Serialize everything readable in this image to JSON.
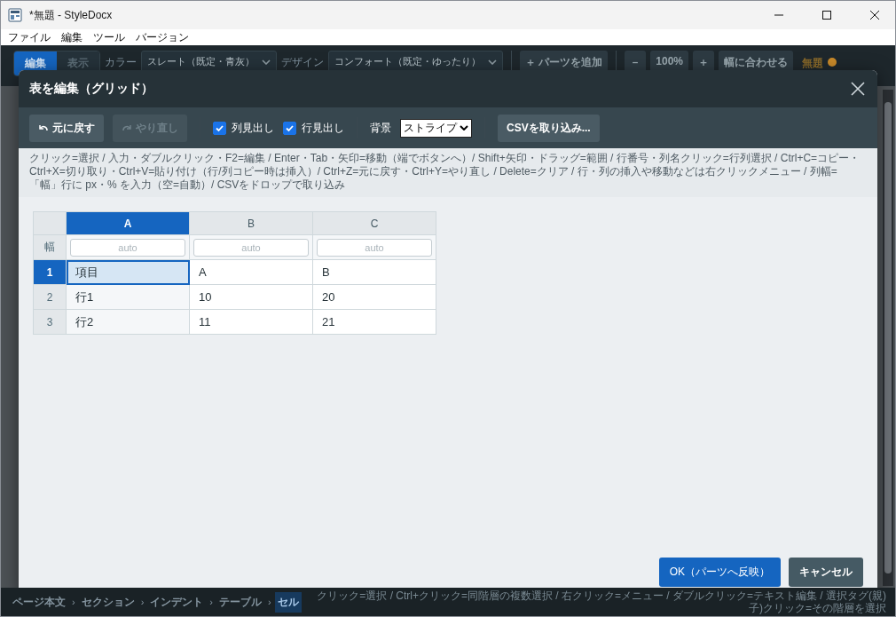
{
  "window": {
    "title": "*無題 - StyleDocx"
  },
  "menu": [
    "ファイル",
    "編集",
    "ツール",
    "バージョン"
  ],
  "app_toolbar": {
    "modes": [
      {
        "label": "編集",
        "selected": true
      },
      {
        "label": "表示",
        "selected": false
      }
    ],
    "color_label": "カラー",
    "color_value": "スレート（既定・青灰）",
    "design_label": "デザイン",
    "design_value": "コンフォート（既定・ゆったり）",
    "add_part": "＋ パーツを追加",
    "zoom_out": "－",
    "zoom": "100%",
    "zoom_in": "＋",
    "fit_width": "幅に合わせる",
    "doc_name": "無題"
  },
  "dialog": {
    "title": "表を編集（グリッド）",
    "undo": {
      "label": "元に戻す",
      "disabled": false
    },
    "redo": {
      "label": "やり直し",
      "disabled": true
    },
    "checks": [
      {
        "label": "列見出し",
        "checked": true
      },
      {
        "label": "行見出し",
        "checked": true
      }
    ],
    "background_label": "背景",
    "background_value": "ストライプ",
    "csv_button": "CSVを取り込み...",
    "help": "クリック=選択 / 入力・ダブルクリック・F2=編集 / Enter・Tab・矢印=移動（端でボタンへ）/ Shift+矢印・ドラッグ=範囲 / 行番号・列名クリック=行列選択 / Ctrl+C=コピー・Ctrl+X=切り取り・Ctrl+V=貼り付け（行/列コピー時は挿入）/ Ctrl+Z=元に戻す・Ctrl+Y=やり直し / Delete=クリア / 行・列の挿入や移動などは右クリックメニュー / 列幅=「幅」行に px・% を入力（空=自動）/ CSVをドロップで取り込み",
    "grid": {
      "width_label": "幅",
      "columns": [
        {
          "label": "A",
          "selected": true,
          "width_placeholder": "auto"
        },
        {
          "label": "B",
          "selected": false,
          "width_placeholder": "auto"
        },
        {
          "label": "C",
          "selected": false,
          "width_placeholder": "auto"
        }
      ],
      "rows": [
        {
          "label": "1",
          "selected": true,
          "cells": [
            {
              "text": "項目",
              "selected": true
            },
            {
              "text": "A",
              "selected": false
            },
            {
              "text": "B",
              "selected": false
            }
          ]
        },
        {
          "label": "2",
          "selected": false,
          "cells": [
            {
              "text": "行1",
              "selected": false
            },
            {
              "text": "10",
              "selected": false
            },
            {
              "text": "20",
              "selected": false
            }
          ]
        },
        {
          "label": "3",
          "selected": false,
          "cells": [
            {
              "text": "行2",
              "selected": false
            },
            {
              "text": "11",
              "selected": false
            },
            {
              "text": "21",
              "selected": false
            }
          ]
        }
      ]
    },
    "ok": "OK（パーツへ反映）",
    "cancel": "キャンセル"
  },
  "status_bar": {
    "separator": "›",
    "breadcrumbs": [
      {
        "label": "ページ本文",
        "selected": false
      },
      {
        "label": "セクション",
        "selected": false
      },
      {
        "label": "インデント",
        "selected": false
      },
      {
        "label": "テーブル",
        "selected": false
      },
      {
        "label": "セル",
        "selected": true
      }
    ],
    "hint": "クリック=選択 / Ctrl+クリック=同階層の複数選択 / 右クリック=メニュー / ダブルクリック=テキスト編集 / 選択タグ(親)子)クリック=その階層を選択"
  }
}
